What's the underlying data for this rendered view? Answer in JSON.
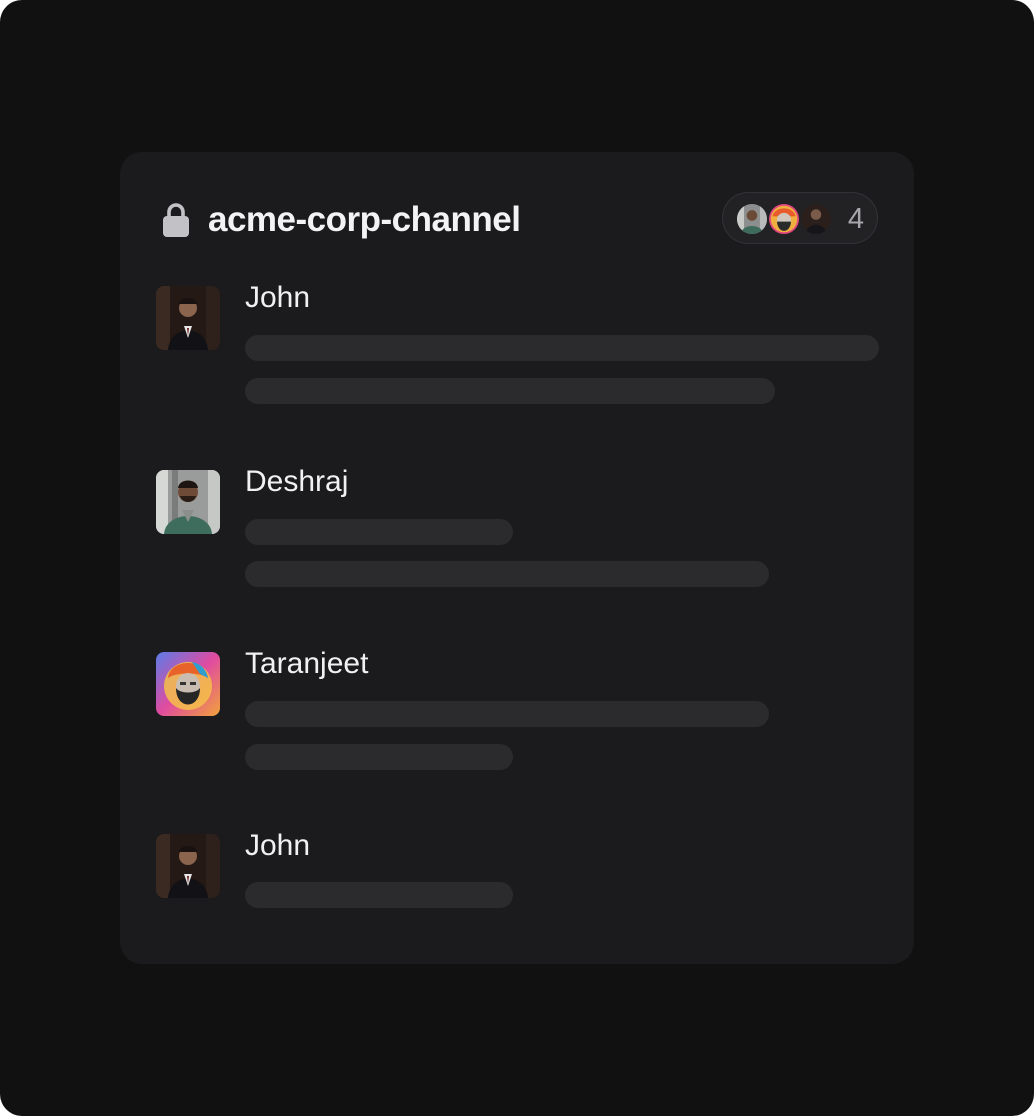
{
  "channel": {
    "name": "acme-corp-channel",
    "lock_icon": "lock-icon",
    "member_count": "4",
    "member_avatars": [
      "Deshraj",
      "Taranjeet",
      "John"
    ]
  },
  "messages": [
    {
      "author": "John",
      "placeholder_lines": 2
    },
    {
      "author": "Deshraj",
      "placeholder_lines": 2
    },
    {
      "author": "Taranjeet",
      "placeholder_lines": 2
    },
    {
      "author": "John",
      "placeholder_lines": 1
    }
  ],
  "colors": {
    "background": "#111112",
    "card": "#1b1b1d",
    "text": "#f1f1f3",
    "placeholder_bar": "#2b2b2e"
  }
}
